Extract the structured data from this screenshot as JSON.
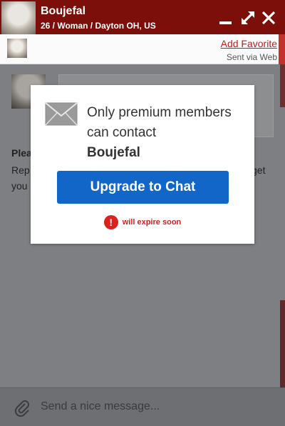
{
  "header": {
    "name": "Boujefal",
    "details": "26 / Woman / Dayton OH, US"
  },
  "subheader": {
    "add_favorite": "Add Favorite",
    "sent_via": "Sent via Web"
  },
  "background": {
    "line1": "Plea",
    "line2": "Rep",
    "line3": "you",
    "right_fragment": "get"
  },
  "modal": {
    "message": "Only premium members can contact",
    "name": "Boujefal",
    "upgrade_label": "Upgrade to Chat",
    "expire_icon": "!",
    "expire_text": "will expire soon"
  },
  "input": {
    "placeholder": "Send a nice message..."
  },
  "icons": {
    "minimize": "minimize-icon",
    "expand": "expand-icon",
    "close": "close-icon",
    "envelope": "envelope-icon",
    "warning": "warning-icon",
    "attach": "paperclip-icon"
  },
  "colors": {
    "header_bg": "#7d0f0a",
    "accent_button": "#1166c8",
    "warning": "#d5201f",
    "link": "#c01d1d"
  }
}
